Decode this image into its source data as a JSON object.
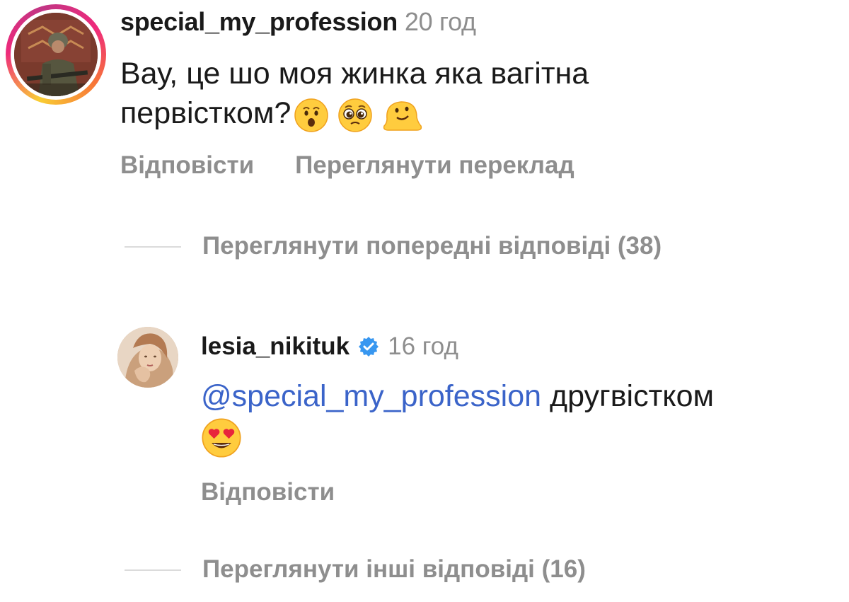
{
  "comment": {
    "username": "special_my_profession",
    "time": "20 год",
    "text": "Вау, це шо моя жинка яка вагітна первістком?",
    "emojis": [
      "hushed-face-emoji",
      "pleading-face-emoji",
      "melting-face-emoji"
    ],
    "actions": {
      "reply": "Відповісти",
      "see_translation": "Переглянути переклад"
    }
  },
  "view_previous_replies": "Переглянути попередні відповіді (38)",
  "reply": {
    "username": "lesia_nikituk",
    "verified": true,
    "time": "16 год",
    "mention": "@special_my_profession",
    "text": " другвістком",
    "emojis": [
      "heart-eyes-emoji"
    ],
    "actions": {
      "reply": "Відповісти"
    }
  },
  "view_more_replies": "Переглянути інші відповіді (16)",
  "colors": {
    "primary_text": "#1a1a1a",
    "secondary_text": "#8e8e8e",
    "mention": "#3b64c9",
    "verified": "#3897f0",
    "divider": "#dbdbdb"
  }
}
